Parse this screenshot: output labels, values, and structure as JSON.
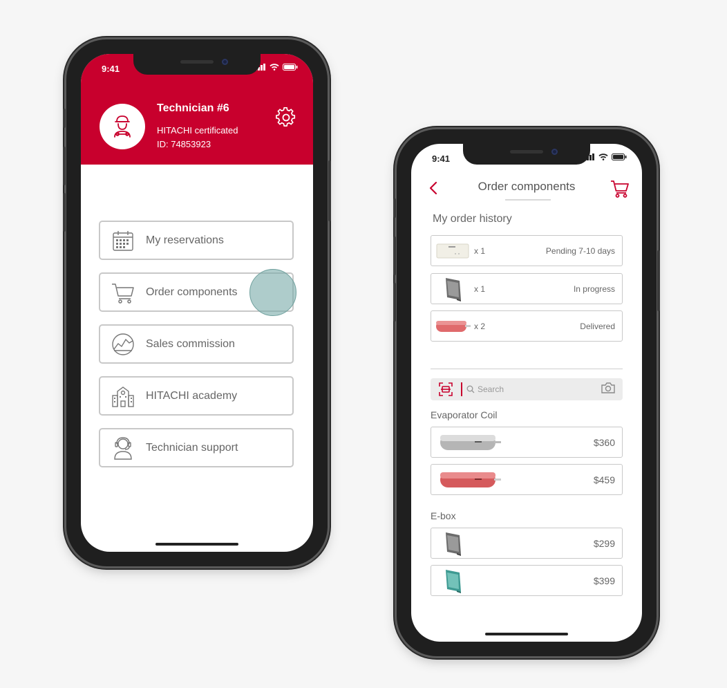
{
  "status_time": "9:41",
  "colors": {
    "brand": "#c8002d",
    "tap_indicator": "#78aaa8"
  },
  "profile": {
    "name": "Technician #6",
    "certification": "HITACHI certificated",
    "id_text": "ID: 74853923",
    "avatar_icon": "technician-avatar-icon",
    "settings_icon": "gear-icon"
  },
  "menu": [
    {
      "label": "My reservations",
      "icon": "calendar-icon"
    },
    {
      "label": "Order components",
      "icon": "cart-icon"
    },
    {
      "label": "Sales commission",
      "icon": "chart-icon"
    },
    {
      "label": "HITACHI academy",
      "icon": "building-icon"
    },
    {
      "label": "Technician support",
      "icon": "headset-icon"
    }
  ],
  "order": {
    "title": "Order components",
    "history_title": "My order history",
    "history": [
      {
        "qty": "x 1",
        "status": "Pending 7-10 days",
        "product": "white-unit"
      },
      {
        "qty": "x 1",
        "status": "In progress",
        "product": "gray-ebox"
      },
      {
        "qty": "x 2",
        "status": "Delivered",
        "product": "red-coil"
      }
    ],
    "search_placeholder": "Search",
    "categories": [
      {
        "name": "Evaporator Coil",
        "items": [
          {
            "price": "$360",
            "product": "silver-coil"
          },
          {
            "price": "$459",
            "product": "red-coil"
          }
        ]
      },
      {
        "name": "E-box",
        "items": [
          {
            "price": "$299",
            "product": "gray-ebox"
          },
          {
            "price": "$399",
            "product": "teal-ebox"
          }
        ]
      }
    ]
  }
}
